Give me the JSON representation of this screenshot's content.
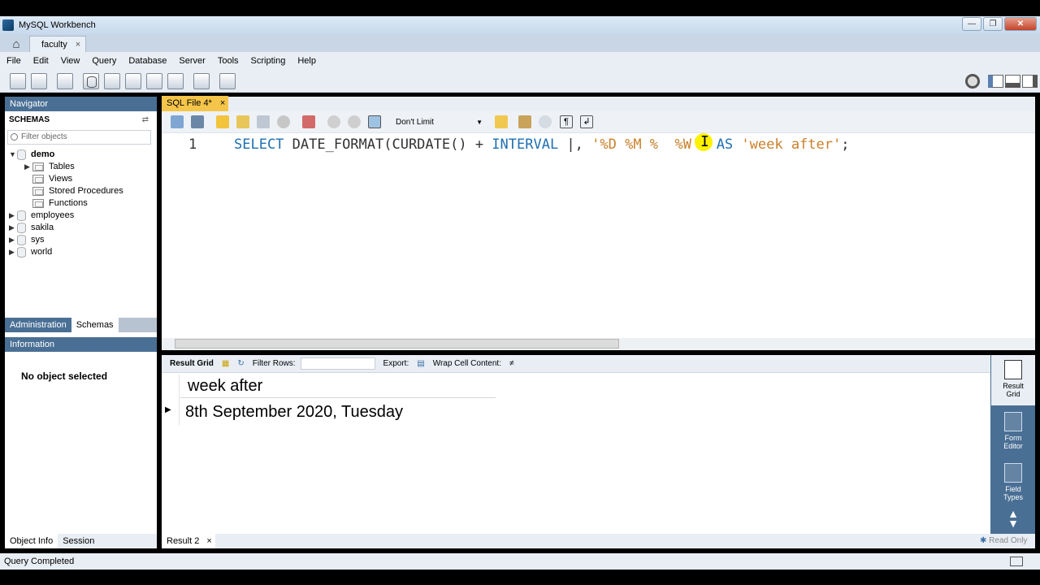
{
  "window": {
    "title": "MySQL Workbench"
  },
  "connection_tab": {
    "label": "faculty",
    "close": "×"
  },
  "menu": [
    "File",
    "Edit",
    "View",
    "Query",
    "Database",
    "Server",
    "Tools",
    "Scripting",
    "Help"
  ],
  "navigator": {
    "header": "Navigator",
    "schemas_label": "SCHEMAS",
    "filter_placeholder": "Filter objects",
    "tree": [
      {
        "label": "demo",
        "expanded": true,
        "bold": true
      },
      {
        "label": "Tables"
      },
      {
        "label": "Views"
      },
      {
        "label": "Stored Procedures"
      },
      {
        "label": "Functions"
      },
      {
        "label": "employees"
      },
      {
        "label": "sakila"
      },
      {
        "label": "sys"
      },
      {
        "label": "world"
      }
    ],
    "bottom_tabs": [
      "Administration",
      "Schemas"
    ]
  },
  "information": {
    "header": "Information",
    "message": "No object selected",
    "tabs": [
      "Object Info",
      "Session"
    ]
  },
  "editor": {
    "tab_label": "SQL File 4*",
    "tab_close": "×",
    "limit_select": "Don't Limit",
    "line_number": "1",
    "code_tokens": {
      "select": "SELECT",
      "func": " DATE_FORMAT(CURDATE() + ",
      "interval": "INTERVAL",
      "mid": " |, ",
      "fmt": "'%D %M %  %W'",
      "close": ") ",
      "as": "AS",
      "alias": " 'week after'",
      "end": ";"
    }
  },
  "result_toolbar": {
    "result_grid": "Result Grid",
    "filter_rows": "Filter Rows:",
    "export": "Export:",
    "wrap": "Wrap Cell Content:"
  },
  "result_grid": {
    "columns": [
      "week after"
    ],
    "rows": [
      [
        "8th September 2020, Tuesday"
      ]
    ]
  },
  "side_buttons": [
    {
      "label_1": "Result",
      "label_2": "Grid"
    },
    {
      "label_1": "Form",
      "label_2": "Editor"
    },
    {
      "label_1": "Field",
      "label_2": "Types"
    }
  ],
  "result_tab": {
    "label": "Result 2",
    "close": "×"
  },
  "read_only": "Read Only",
  "status": "Query Completed",
  "colors": {
    "accent_blue": "#4a6f94",
    "active_tab": "#f4c54a",
    "keyword": "#1f6fb2",
    "string": "#c9812b"
  }
}
